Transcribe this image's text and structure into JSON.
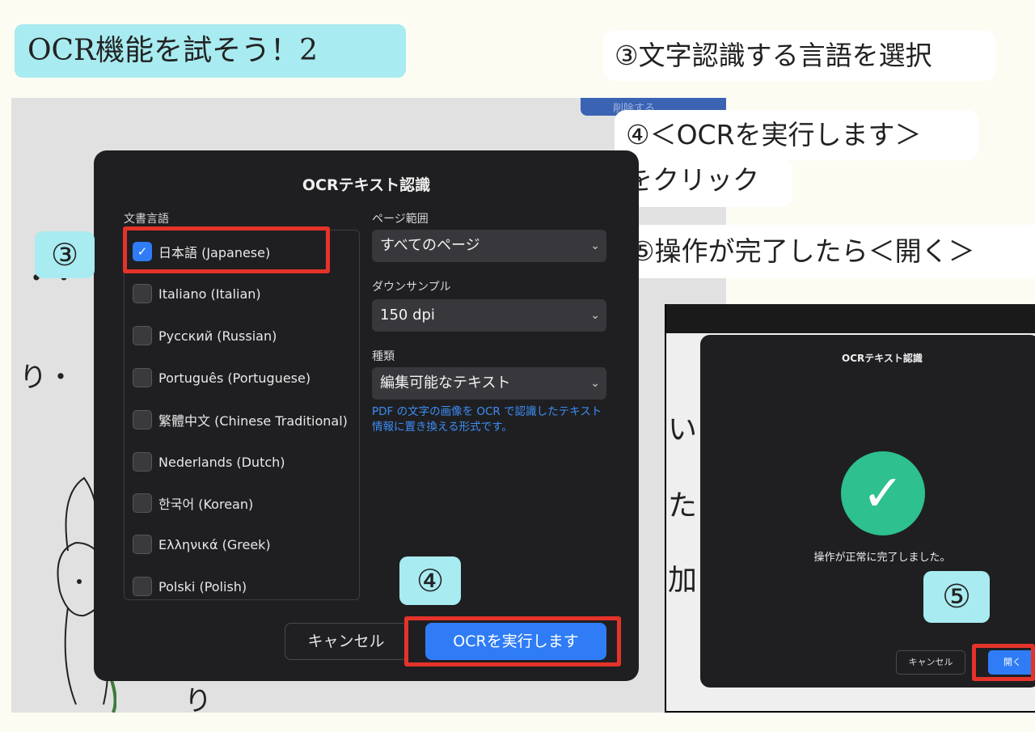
{
  "title": "OCR機能を試そう！2",
  "callouts": {
    "step3": "③文字認識する言語を選択",
    "step4_line1": "④＜OCRを実行します＞",
    "step4_line2": "をクリック",
    "step5": "⑤操作が完了したら＜開く＞"
  },
  "badges": {
    "b3": "③",
    "b4": "④",
    "b5": "⑤"
  },
  "background": {
    "top_button": "削除する",
    "glyph_dots": "・・",
    "glyph_ri": "り・",
    "glyph_i": "い",
    "glyph_ta": "た",
    "glyph_ka": "加",
    "glyph_ri2": "り"
  },
  "dialog": {
    "title": "OCRテキスト認識",
    "language_label": "文書言語",
    "languages": [
      {
        "label": "日本語 (Japanese)",
        "checked": true
      },
      {
        "label": "Italiano (Italian)",
        "checked": false
      },
      {
        "label": "Русский (Russian)",
        "checked": false
      },
      {
        "label": "Português (Portuguese)",
        "checked": false
      },
      {
        "label": "繁體中文 (Chinese Traditional)",
        "checked": false
      },
      {
        "label": "Nederlands (Dutch)",
        "checked": false
      },
      {
        "label": "한국어 (Korean)",
        "checked": false
      },
      {
        "label": "Ελληνικά (Greek)",
        "checked": false
      },
      {
        "label": "Polski (Polish)",
        "checked": false
      }
    ],
    "page_range_label": "ページ範囲",
    "page_range_value": "すべてのページ",
    "downsample_label": "ダウンサンプル",
    "downsample_value": "150 dpi",
    "type_label": "種類",
    "type_value": "編集可能なテキスト",
    "type_hint": "PDF の文字の画像を OCR で認識したテキスト情報に置き換える形式です。",
    "cancel_label": "キャンセル",
    "ocr_label": "OCRを実行します",
    "chevron": "⌄",
    "check": "✓"
  },
  "result_dialog": {
    "title": "OCRテキスト認識",
    "message": "操作が正常に完了しました。",
    "cancel_label": "キャンセル",
    "open_label": "開く",
    "check": "✓"
  },
  "colors": {
    "accent_blue": "#2f7cf6",
    "success_green": "#2ec08f",
    "highlight_red": "#e5332a",
    "tag_cyan": "#a8ebf0"
  }
}
